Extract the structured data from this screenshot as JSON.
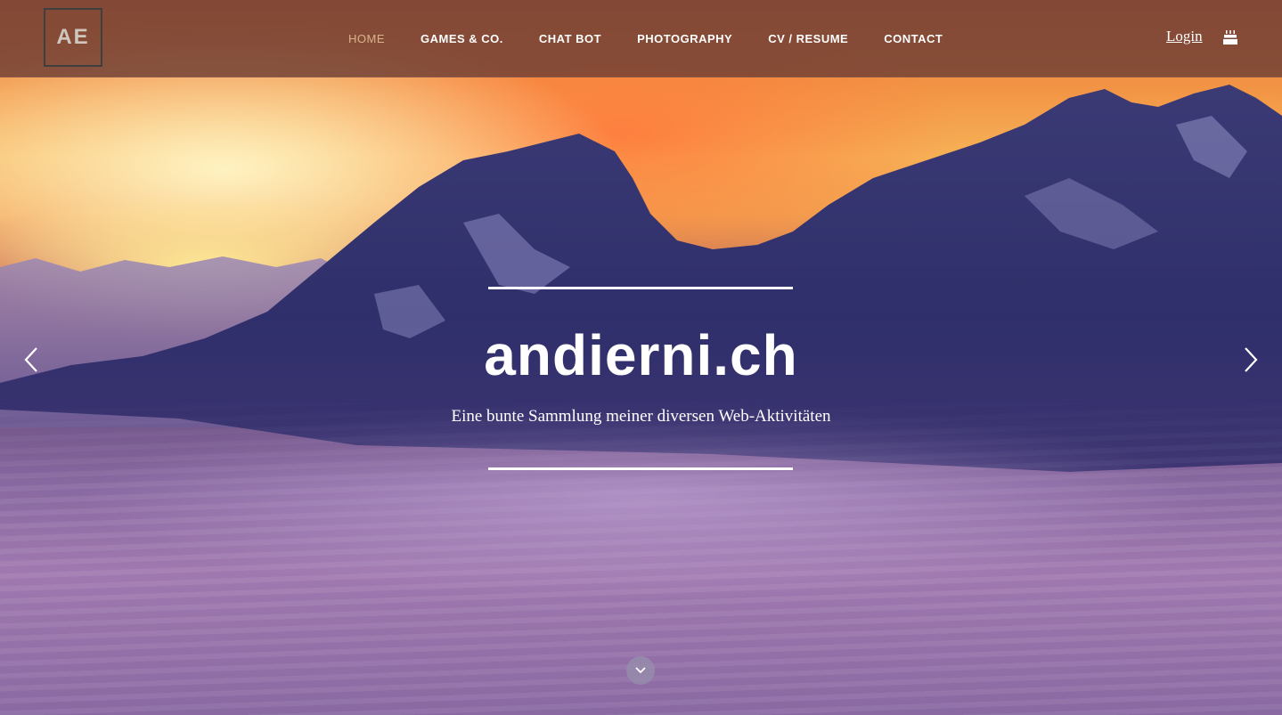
{
  "logo": {
    "text": "AE"
  },
  "nav": {
    "items": [
      {
        "label": "HOME",
        "active": true
      },
      {
        "label": "GAMES & CO.",
        "active": false
      },
      {
        "label": "CHAT BOT",
        "active": false
      },
      {
        "label": "PHOTOGRAPHY",
        "active": false
      },
      {
        "label": "CV / RESUME",
        "active": false
      },
      {
        "label": "CONTACT",
        "active": false
      }
    ],
    "login_label": "Login",
    "user_icon": "cake-icon"
  },
  "hero": {
    "title": "andierni.ch",
    "subtitle": "Eine bunte Sammlung meiner diversen Web-Aktivitäten",
    "prev_icon": "chevron-left-icon",
    "next_icon": "chevron-right-icon",
    "scroll_icon": "chevron-down-icon"
  },
  "colors": {
    "nav_background": "#6e3e34",
    "active_nav": "#d9b38c",
    "text": "#ffffff"
  }
}
